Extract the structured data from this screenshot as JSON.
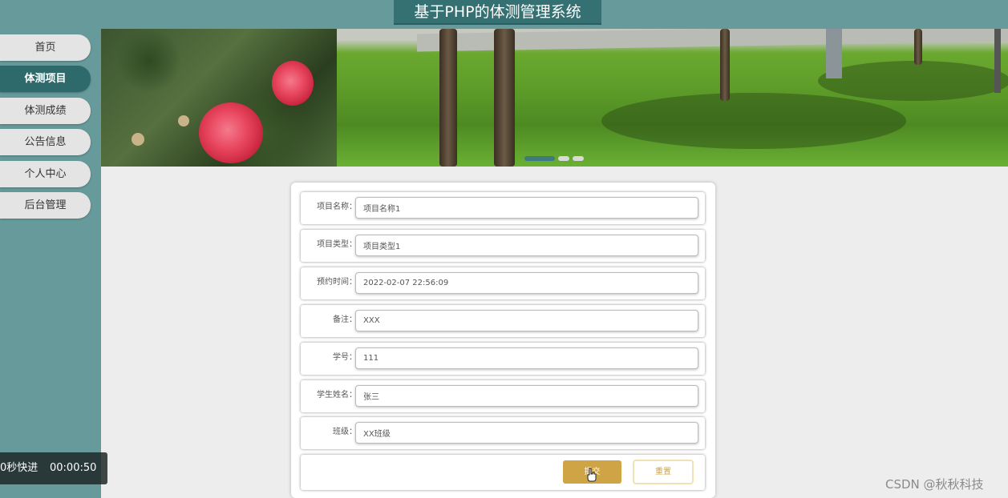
{
  "header": {
    "title": "基于PHP的体测管理系统"
  },
  "sidebar": {
    "items": [
      {
        "label": "首页"
      },
      {
        "label": "体测项目"
      },
      {
        "label": "体测成绩"
      },
      {
        "label": "公告信息"
      },
      {
        "label": "个人中心"
      },
      {
        "label": "后台管理"
      }
    ],
    "active": "体测项目"
  },
  "carousel": {
    "slides_count": 3,
    "active_slide": 1
  },
  "form": {
    "fields": [
      {
        "label": "项目名称：",
        "value": "项目名称1"
      },
      {
        "label": "项目类型：",
        "value": "项目类型1"
      },
      {
        "label": "预约时间：",
        "value": "2022-02-07 22:56:09"
      },
      {
        "label": "备注：",
        "value": "XXX"
      },
      {
        "label": "学号：",
        "value": "111"
      },
      {
        "label": "学生姓名：",
        "value": "张三"
      },
      {
        "label": "班级：",
        "value": "XX班级"
      }
    ],
    "submit_label": "提交",
    "reset_label": "重置"
  },
  "video_overlay": {
    "label": "0秒快进",
    "time": "00:00:50"
  },
  "watermark": "CSDN @秋秋科技",
  "colors": {
    "teal": "#679a9a",
    "dark_teal": "#357073",
    "gold": "#cfa444"
  }
}
